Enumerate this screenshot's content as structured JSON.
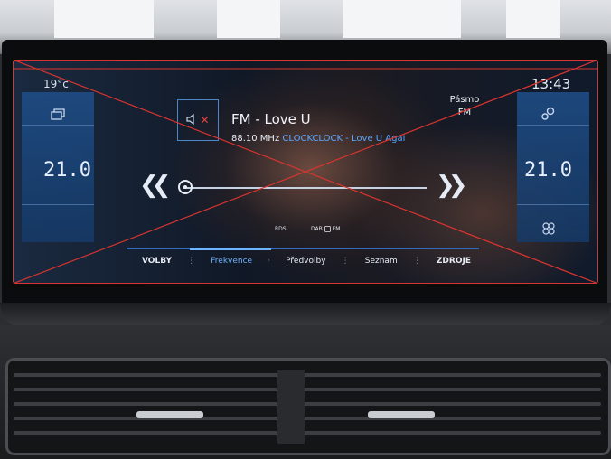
{
  "status": {
    "outside_temp": "19°c",
    "clock": "13:43"
  },
  "climate": {
    "left_temp": "21.0",
    "right_temp": "21.0"
  },
  "radio": {
    "station_title": "FM - Love U",
    "frequency": "88.10 MHz",
    "radio_text": "CLOCKCLOCK - Love U Agai",
    "band_label_line1": "Pásmo",
    "band_label_line2": "FM",
    "rds_label": "RDS",
    "dab_label": "DAB",
    "dab_fm_label": "FM"
  },
  "menu": {
    "items": [
      "VOLBY",
      "Frekvence",
      "Předvolby",
      "Seznam",
      "ZDROJE"
    ],
    "active": "Frekvence"
  },
  "icons": {
    "left_top": "layers-icon",
    "mute": "mute-speaker-icon",
    "right_top": "settings-gears-icon",
    "right_bottom": "fan-icon",
    "prev": "double-chevron-left-icon",
    "next": "double-chevron-right-icon"
  },
  "colors": {
    "accent": "#2f6cc0",
    "active_text": "#6fb1ff",
    "overlay_red": "#d9342f",
    "panel_blue": "#1f4f8a"
  }
}
